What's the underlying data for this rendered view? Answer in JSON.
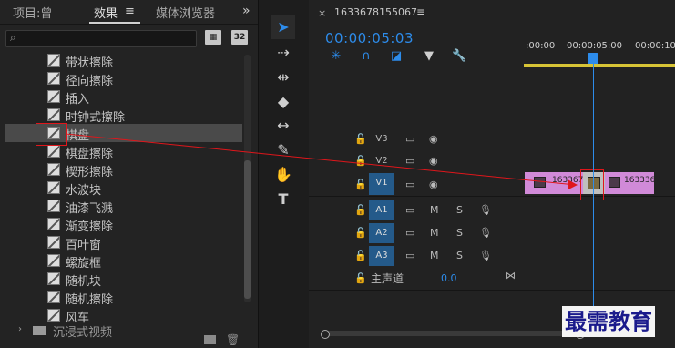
{
  "effects_panel": {
    "tabs": [
      {
        "label": "项目:曾",
        "active": false
      },
      {
        "label": "效果",
        "active": true
      },
      {
        "label": "媒体浏览器",
        "active": false
      }
    ],
    "tab_menu_icon": "hamburger-icon",
    "overflow_icon": "double-chevron-right-icon",
    "search": {
      "value": "",
      "placeholder": ""
    },
    "badges": [
      "32"
    ],
    "items": [
      {
        "label": "带状擦除",
        "selected": false
      },
      {
        "label": "径向擦除",
        "selected": false
      },
      {
        "label": "插入",
        "selected": false
      },
      {
        "label": "时钟式擦除",
        "selected": false
      },
      {
        "label": "棋盘",
        "selected": true
      },
      {
        "label": "棋盘擦除",
        "selected": false
      },
      {
        "label": "楔形擦除",
        "selected": false
      },
      {
        "label": "水波块",
        "selected": false
      },
      {
        "label": "油漆飞溅",
        "selected": false
      },
      {
        "label": "渐变擦除",
        "selected": false
      },
      {
        "label": "百叶窗",
        "selected": false
      },
      {
        "label": "螺旋框",
        "selected": false
      },
      {
        "label": "随机块",
        "selected": false
      },
      {
        "label": "随机擦除",
        "selected": false
      },
      {
        "label": "风车",
        "selected": false
      }
    ],
    "folder_label": "沉浸式视频"
  },
  "tools": [
    "selection-tool-icon",
    "track-select-icon",
    "ripple-edit-icon",
    "razor-icon",
    "slip-icon",
    "pen-icon",
    "hand-icon",
    "type-icon"
  ],
  "timeline": {
    "close": "×",
    "sequence_name": "1633678155067",
    "menu": "≡",
    "timecode": "00:00:05:03",
    "ruler_labels": [
      ":00:00",
      "00:00:05:00",
      "00:00:10"
    ],
    "video_tracks": [
      {
        "name": "V3",
        "targeted": false
      },
      {
        "name": "V2",
        "targeted": false
      },
      {
        "name": "V1",
        "targeted": true
      }
    ],
    "audio_tracks": [
      {
        "name": "A1",
        "m": "M",
        "s": "S"
      },
      {
        "name": "A2",
        "m": "M",
        "s": "S"
      },
      {
        "name": "A3",
        "m": "M",
        "s": "S"
      }
    ],
    "master": {
      "label": "主声道",
      "value": "0.0"
    },
    "clips": [
      {
        "label": "1633678"
      },
      {
        "label": "1633367"
      }
    ],
    "colors": {
      "accent": "#2d8ceb",
      "clip": "#d18ad8",
      "highlight": "#e0161b",
      "work_area": "#d7c436"
    }
  },
  "watermark": "最需教育"
}
